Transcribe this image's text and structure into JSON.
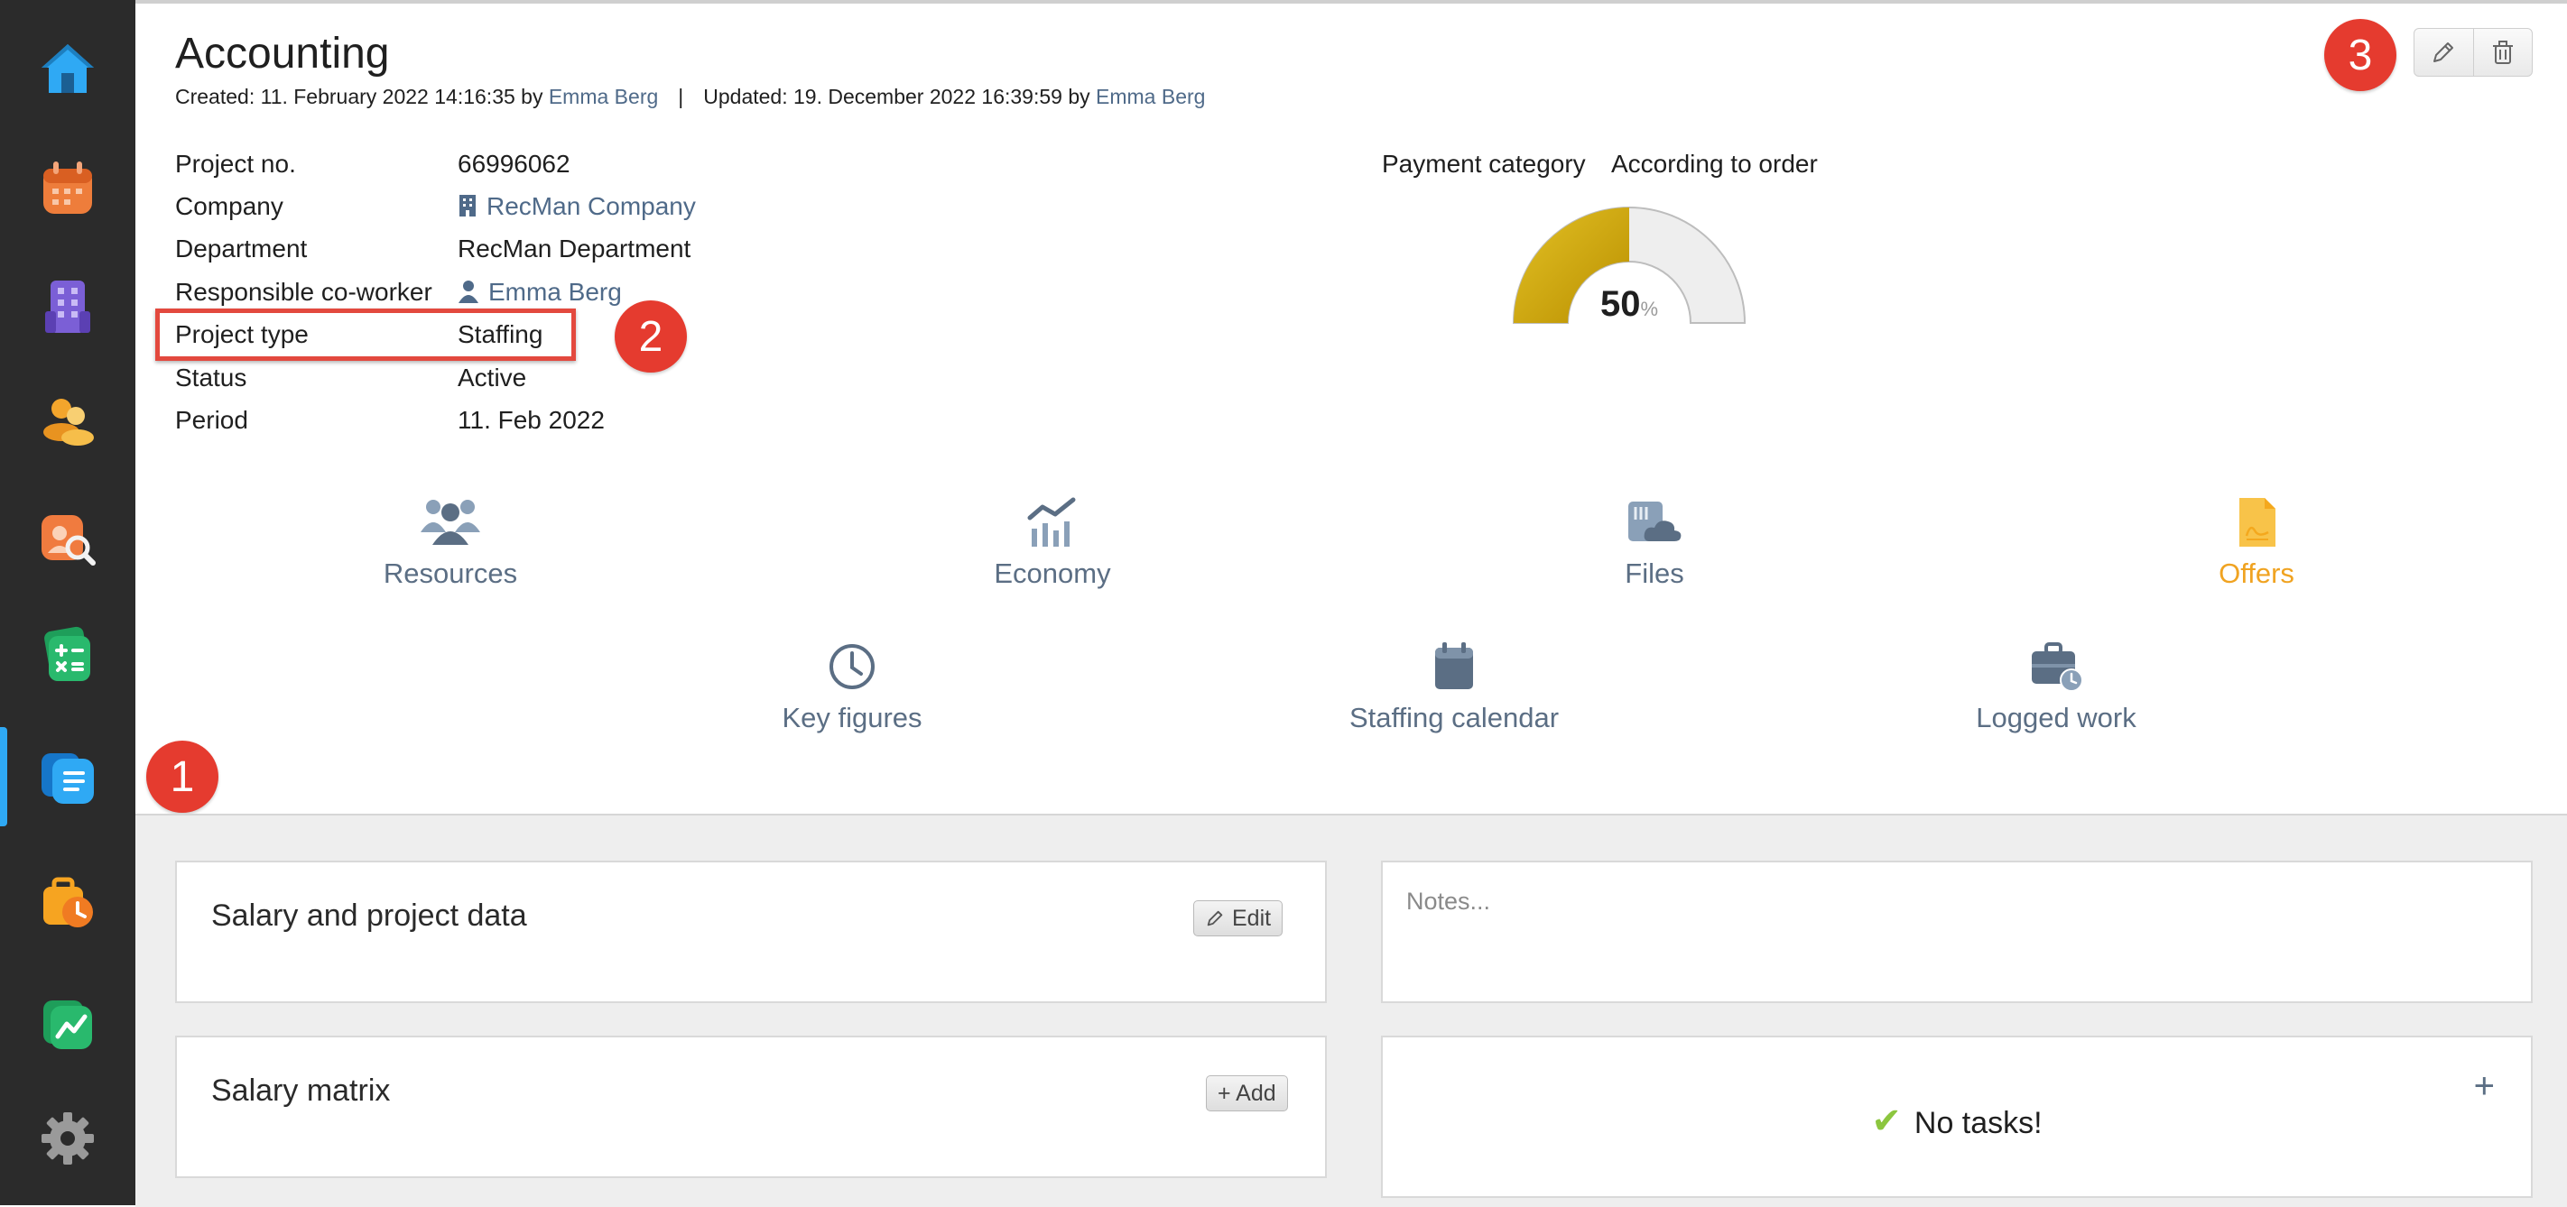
{
  "sidebar": {
    "items": [
      {
        "name": "home-icon"
      },
      {
        "name": "calendar-icon"
      },
      {
        "name": "building-icon"
      },
      {
        "name": "candidates-icon"
      },
      {
        "name": "search-people-icon"
      },
      {
        "name": "calculator-icon"
      },
      {
        "name": "projects-icon",
        "active": true
      },
      {
        "name": "timesheet-icon"
      },
      {
        "name": "chart-icon"
      },
      {
        "name": "settings-icon"
      }
    ],
    "active_color": "#2fa9f4"
  },
  "header": {
    "title": "Accounting",
    "created_text": "Created: 11. February 2022 14:16:35 by ",
    "created_by": "Emma Berg",
    "separator": "|",
    "updated_text": "Updated: 19. December 2022 16:39:59 by ",
    "updated_by": "Emma Berg",
    "edit_icon": "pencil-icon",
    "delete_icon": "trash-icon"
  },
  "markers": [
    "1",
    "2",
    "3"
  ],
  "properties": {
    "project_no": {
      "label": "Project no.",
      "value": "66996062"
    },
    "company": {
      "label": "Company",
      "value": "RecMan Company"
    },
    "department": {
      "label": "Department",
      "value": "RecMan Department"
    },
    "coworker": {
      "label": "Responsible co-worker",
      "value": "Emma Berg"
    },
    "project_type": {
      "label": "Project type",
      "value": "Staffing"
    },
    "status": {
      "label": "Status",
      "value": "Active"
    },
    "period": {
      "label": "Period",
      "value": "11. Feb 2022"
    }
  },
  "payment": {
    "label": "Payment category",
    "value": "According to order",
    "gauge_value": "50",
    "gauge_unit": "%",
    "gauge_fraction": 0.5,
    "gauge_color": "#d9ac00"
  },
  "shortcuts": [
    {
      "label": "Resources",
      "icon": "people-icon"
    },
    {
      "label": "Economy",
      "icon": "economy-chart-icon"
    },
    {
      "label": "Files",
      "icon": "files-cloud-icon"
    },
    {
      "label": "Offers",
      "icon": "offer-document-icon",
      "color": "#f0a321"
    },
    {
      "label": "Key figures",
      "icon": "clock-icon"
    },
    {
      "label": "Staffing calendar",
      "icon": "calendar-icon"
    },
    {
      "label": "Logged work",
      "icon": "briefcase-clock-icon"
    }
  ],
  "panels": {
    "salary_project": {
      "title": "Salary and project data",
      "button": "Edit"
    },
    "salary_matrix": {
      "title": "Salary matrix",
      "button": "+ Add"
    },
    "notes": {
      "placeholder": "Notes..."
    },
    "tasks": {
      "empty_text": "No tasks!",
      "add": "+"
    }
  }
}
